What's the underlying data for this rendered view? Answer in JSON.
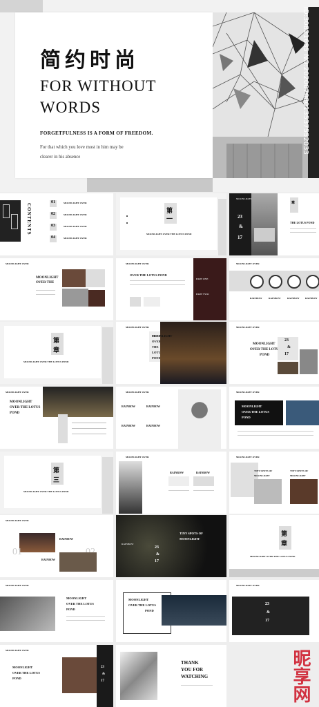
{
  "hero": {
    "title_cn": "简约时尚",
    "title_en_1": "FOR WITHOUT",
    "title_en_2": "WORDS",
    "subtitle": "FORGETFULNESS IS A FORM OF FREEDOM.",
    "quote": "For that which you love most in him may be clearer in his absence",
    "watermark": "ID:30821685 NO:20200708013537552033"
  },
  "slides": {
    "contents": {
      "title": "CONTENTS",
      "items": [
        "01",
        "02",
        "03",
        "04"
      ],
      "item_label": "MOONLIGHT OVER"
    },
    "chapter1": {
      "label_1": "第",
      "label_2": "一",
      "label_3": "章",
      "caption": "MOONLIGHT OVER THE LOTUS POND"
    },
    "station": {
      "badge": "MOONLIGHT OVER",
      "numbers": [
        "23",
        "&",
        "17"
      ],
      "tag_1": "章",
      "tag_2": "第",
      "title": "THE LOTUS POND"
    },
    "over_the": {
      "badge": "MOONLIGHT OVER",
      "title_1": "MOONLIGHT",
      "title_2": "OVER THE"
    },
    "lotus_pond": {
      "badge": "MOONLIGHT OVER",
      "title": "OVER THE LOTUS POND",
      "part_one": "PART ONE",
      "part_two": "PART TWO"
    },
    "clocks": {
      "badge": "MOONLIGHT OVER",
      "labels": [
        "RAINBOW",
        "RAINBOW",
        "RAINBOW",
        "RAINBOW"
      ]
    },
    "chapter2": {
      "label_1": "第",
      "label_2": "二",
      "label_3": "章",
      "caption": "MOONLIGHT OVER THE LOTUS POND"
    },
    "lotus_hall": {
      "badge": "MOONLIGHT OVER",
      "t1": "MOONLIGHT",
      "t2": "OVER",
      "t3": "THE",
      "t4": "LOTUS",
      "t5": "POND"
    },
    "moonlight_1": {
      "badge": "MOONLIGHT OVER",
      "t1": "MOONLIGHT",
      "t2": "OVER THE LOTUS",
      "t3": "POND",
      "n": [
        "23",
        "&",
        "17"
      ]
    },
    "moonlight_2": {
      "badge": "MOONLIGHT OVER",
      "t1": "MOONLIGHT",
      "t2": "OVER THE LOTUS",
      "t3": "POND"
    },
    "rainbow_man": {
      "badge": "MOONLIGHT OVER",
      "r1": "RAINBOW",
      "r2": "RAINBOW",
      "r3": "RAINBOW",
      "r4": "RAINBOW"
    },
    "moonlight_3": {
      "badge": "MOONLIGHT OVER",
      "t1": "MOONLIGHT",
      "t2": "OVER THE LOTUS",
      "t3": "POND"
    },
    "chapter3": {
      "label_1": "第",
      "label_2": "三",
      "label_3": "章",
      "caption": "MOONLIGHT OVER THE LOTUS POND"
    },
    "rainbow_2": {
      "badge": "MOONLIGHT OVER",
      "r1": "RAINBOW",
      "r2": "RAINBOW"
    },
    "tiny_spots": {
      "badge": "MOONLIGHT OVER",
      "t1": "TINY SPOTS OF",
      "t2": "MOONLIGHT",
      "t3": "TINY SPOTS OF",
      "t4": "MOONLIGHT"
    },
    "rainbow_3": {
      "badge": "MOONLIGHT OVER",
      "r1": "RAINBOW",
      "n1": "01",
      "r2": "RAINBOW",
      "n2": "02"
    },
    "dark_spots": {
      "badge": "MOONLIGHT OVER",
      "t1": "TINY SPOTS OF",
      "t2": "MOONLIGHT",
      "r": "RAINBOW",
      "n": [
        "23",
        "&",
        "17"
      ]
    },
    "chapter4": {
      "label_1": "第",
      "label_2": "四",
      "label_3": "章",
      "caption": "MOONLIGHT OVER THE LOTUS POND"
    },
    "tunnel": {
      "badge": "MOONLIGHT OVER"
    },
    "moonlight_4": {
      "t1": "MOONLIGHT",
      "t2": "OVER THE LOTUS",
      "t3": "POND"
    },
    "moonlight_5": {
      "t1": "MOONLIGHT",
      "t2": "OVER THE LOTUS",
      "t3": "POND"
    },
    "dark_numbers": {
      "badge": "MOONLIGHT OVER",
      "n": [
        "23",
        "&",
        "17"
      ]
    },
    "lotus_last": {
      "badge": "MOONLIGHT OVER",
      "t1": "MOONLIGHT",
      "t2": "OVER THE LOTUS",
      "t3": "POND",
      "n": [
        "23",
        "&",
        "17"
      ]
    },
    "thanks": {
      "t1": "THANK",
      "t2": "YOU FOR",
      "t3": "WATCHING"
    }
  },
  "site_logo": "昵享网"
}
